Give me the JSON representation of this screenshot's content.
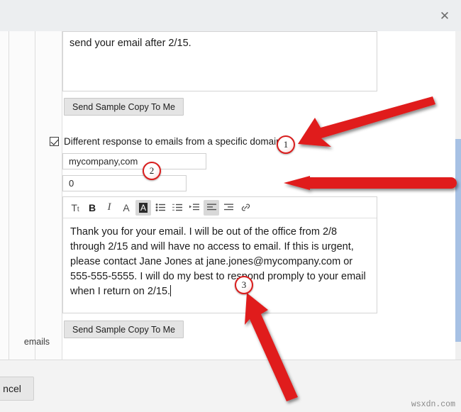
{
  "window": {
    "close_icon": "close-icon",
    "close_glyph": "✕"
  },
  "scroll": {
    "thumb_color": "#a7c1e4"
  },
  "top_message": {
    "visible_text": "send your email after 2/15."
  },
  "buttons": {
    "send_sample_top": "Send Sample Copy To Me",
    "send_sample_bottom": "Send Sample Copy To Me",
    "cancel": "ncel"
  },
  "domain_option": {
    "checked": true,
    "label": "Different response to emails from a specific domain"
  },
  "fields": {
    "domain_value": "mycompany,com",
    "domain_placeholder": "mycompany,com",
    "count_value": "0",
    "count_placeholder": "0"
  },
  "editor": {
    "toolbar": [
      {
        "name": "font-size-icon",
        "glyph": "Tt",
        "active": false
      },
      {
        "name": "bold-icon",
        "glyph": "B",
        "active": false
      },
      {
        "name": "italic-icon",
        "glyph": "I",
        "active": false
      },
      {
        "name": "font-color-icon",
        "glyph": "A",
        "active": false
      },
      {
        "name": "highlight-color-icon",
        "glyph": "A",
        "active": true
      },
      {
        "name": "bulleted-list-icon",
        "glyph": "",
        "active": false
      },
      {
        "name": "numbered-list-icon",
        "glyph": "",
        "active": false
      },
      {
        "name": "increase-indent-icon",
        "glyph": "",
        "active": false
      },
      {
        "name": "align-left-icon",
        "glyph": "",
        "active": true
      },
      {
        "name": "align-right-icon",
        "glyph": "",
        "active": false
      },
      {
        "name": "insert-link-icon",
        "glyph": "",
        "active": false
      }
    ],
    "body_text": "Thank you for your email. I will be out of the office from 2/8 through 2/15 and will have no access to email. If this is urgent, please contact Jane Jones at jane.jones@mycompany.com or 555-555-5555. I will do my best to respond promply to your email when I return on 2/15."
  },
  "left_gutter": {
    "partial_text": "emails"
  },
  "annotations": {
    "accent_color": "#e01b1b",
    "badges": [
      {
        "label": "1"
      },
      {
        "label": "2"
      },
      {
        "label": "3"
      }
    ]
  },
  "watermark": {
    "text": "wsxdn.com"
  }
}
